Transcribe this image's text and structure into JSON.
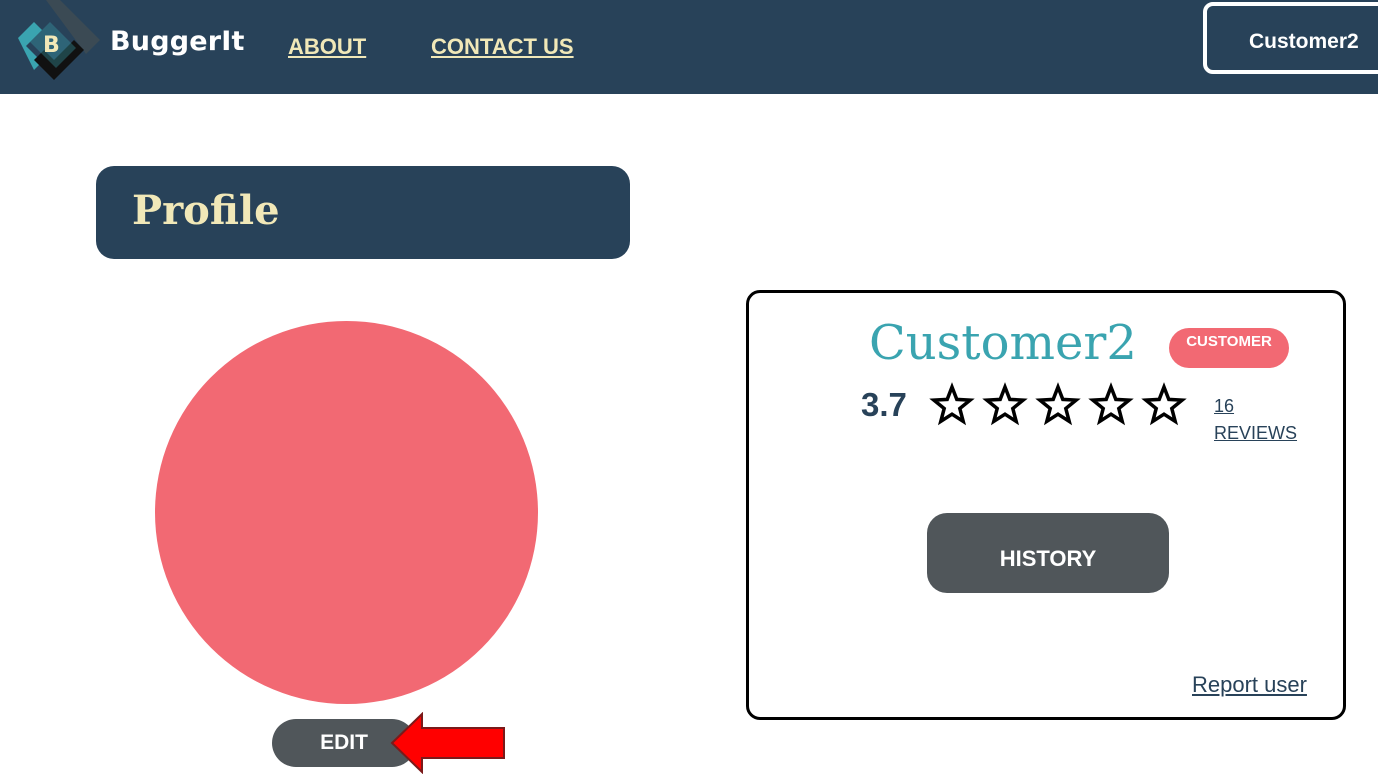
{
  "header": {
    "brand": "BuggerIt",
    "logo_letter": "B",
    "nav": {
      "about": "ABOUT",
      "contact": "CONTACT US"
    },
    "user_button": "Customer2"
  },
  "profile": {
    "title": "Profile",
    "edit_label": "EDIT"
  },
  "card": {
    "username": "Customer2",
    "role_badge": "CUSTOMER",
    "rating": "3.7",
    "star_count": 5,
    "reviews_count": "16",
    "reviews_label": "REVIEWS",
    "history_label": "HISTORY",
    "report_label": "Report user"
  },
  "colors": {
    "navy": "#284259",
    "cream": "#f1e8b8",
    "coral": "#f26973",
    "teal": "#3aa4b0",
    "gray_button": "#50565a",
    "annotation_arrow": "#ff0000"
  },
  "icons": {
    "logo": "buggerit-logo-icon",
    "star": "star-outline-icon",
    "arrow": "red-arrow-annotation-icon"
  }
}
